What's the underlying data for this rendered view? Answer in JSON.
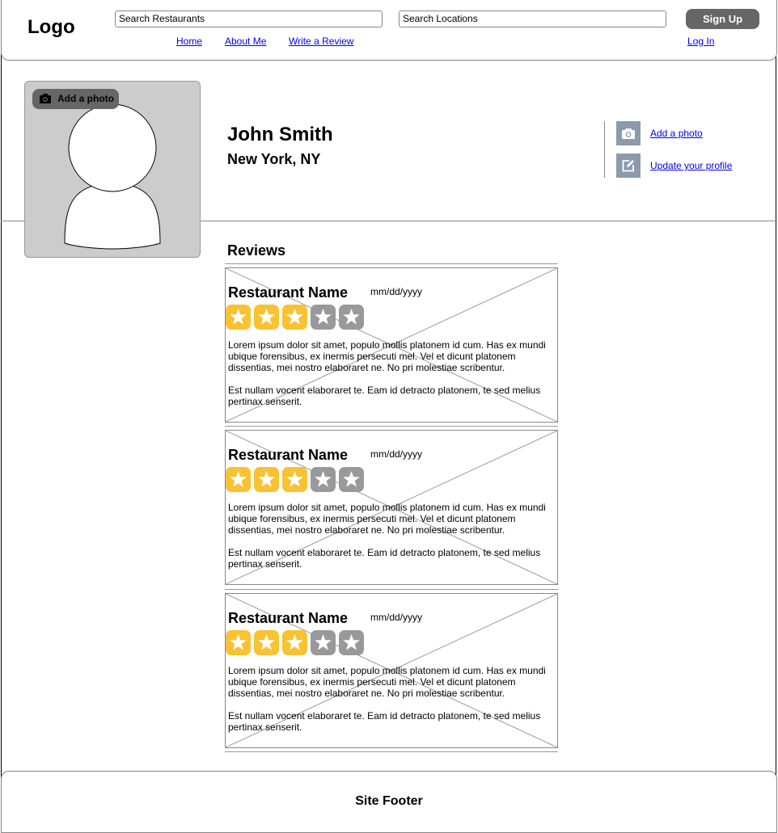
{
  "header": {
    "logo": "Logo",
    "search_restaurants": "Search Restaurants",
    "search_locations": "Search Locations",
    "nav": [
      "Home",
      "About Me",
      "Write a Review"
    ],
    "signup": "Sign Up",
    "login": "Log In"
  },
  "profile": {
    "add_photo_overlay": "Add a photo",
    "name": "John Smith",
    "location": "New York, NY",
    "actions": [
      "Add a photo",
      "Update your profile"
    ]
  },
  "reviews": {
    "title": "Reviews",
    "items": [
      {
        "restaurant": "Restaurant Name",
        "date": "mm/dd/yyyy",
        "rating": 3,
        "max_rating": 5,
        "paragraphs": [
          "Lorem ipsum dolor sit amet, populo mollis platonem id cum. Has ex mundi ubique forensibus, ex inermis persecuti mel. Vel et dicunt platonem dissentias, mei nostro elaboraret ne. No pri molestiae scribentur.",
          "Est nullam vocent elaboraret te. Eam id detracto platonem, te sed melius pertinax senserit."
        ]
      },
      {
        "restaurant": "Restaurant Name",
        "date": "mm/dd/yyyy",
        "rating": 3,
        "max_rating": 5,
        "paragraphs": [
          "Lorem ipsum dolor sit amet, populo mollis platonem id cum. Has ex mundi ubique forensibus, ex inermis persecuti mel. Vel et dicunt platonem dissentias, mei nostro elaboraret ne. No pri molestiae scribentur.",
          "Est nullam vocent elaboraret te. Eam id detracto platonem, te sed melius pertinax senserit."
        ]
      },
      {
        "restaurant": "Restaurant Name",
        "date": "mm/dd/yyyy",
        "rating": 3,
        "max_rating": 5,
        "paragraphs": [
          "Lorem ipsum dolor sit amet, populo mollis platonem id cum. Has ex mundi ubique forensibus, ex inermis persecuti mel. Vel et dicunt platonem dissentias, mei nostro elaboraret ne. No pri molestiae scribentur.",
          "Est nullam vocent elaboraret te. Eam id detracto platonem, te sed melius pertinax senserit."
        ]
      }
    ]
  },
  "footer": {
    "text": "Site Footer"
  },
  "colors": {
    "star_filled": "#f9c233",
    "star_empty": "#999999",
    "action_icon_bg": "#8c9aae",
    "button_bg": "#666666",
    "link": "#0000ee"
  },
  "icons": {
    "camera": "camera-icon",
    "edit": "edit-icon",
    "star": "star-icon"
  }
}
